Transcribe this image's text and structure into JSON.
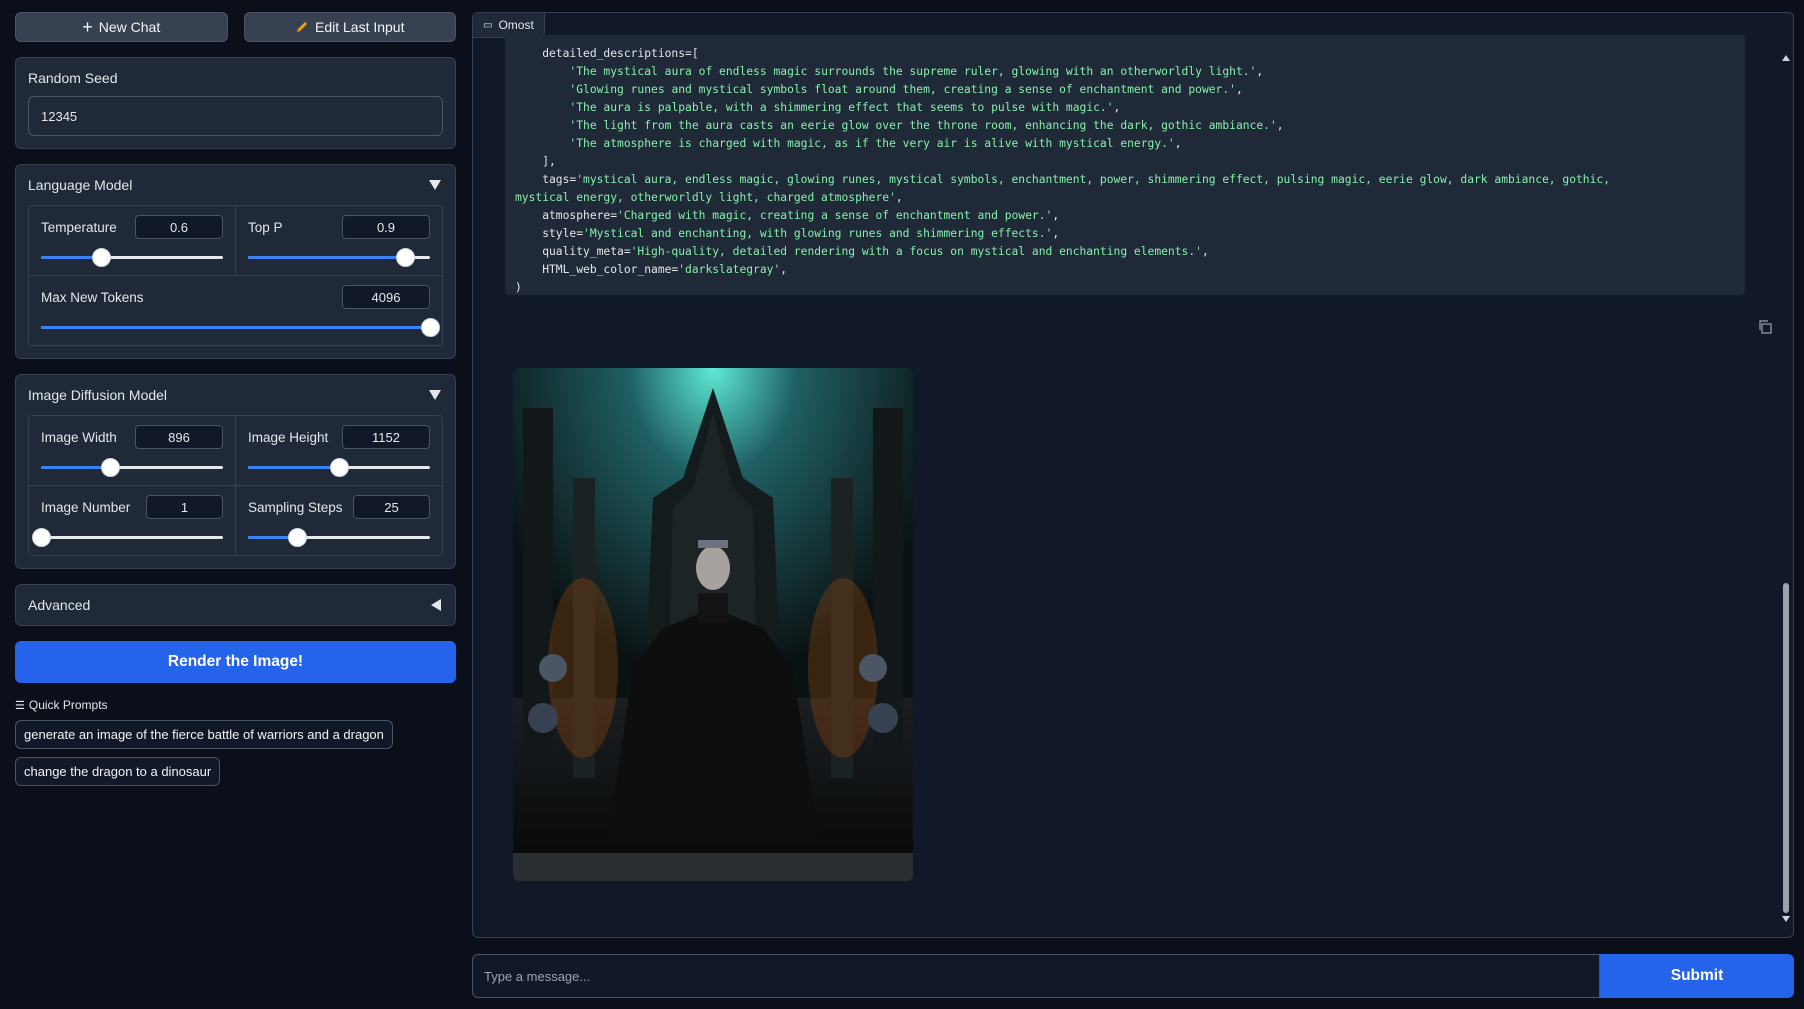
{
  "toolbar": {
    "new_chat": "New Chat",
    "edit_last": "Edit Last Input"
  },
  "seed": {
    "label": "Random Seed",
    "value": "12345"
  },
  "language_model": {
    "title": "Language Model",
    "temperature": {
      "label": "Temperature",
      "value": "0.6",
      "fraction": 0.33
    },
    "top_p": {
      "label": "Top P",
      "value": "0.9",
      "fraction": 0.86
    },
    "max_tokens": {
      "label": "Max New Tokens",
      "value": "4096",
      "fraction": 1.0
    }
  },
  "diffusion_model": {
    "title": "Image Diffusion Model",
    "width": {
      "label": "Image Width",
      "value": "896",
      "fraction": 0.38
    },
    "height": {
      "label": "Image Height",
      "value": "1152",
      "fraction": 0.5
    },
    "number": {
      "label": "Image Number",
      "value": "1",
      "fraction": 0.0
    },
    "steps": {
      "label": "Sampling Steps",
      "value": "25",
      "fraction": 0.27
    }
  },
  "advanced": {
    "title": "Advanced"
  },
  "render_button": "Render the Image!",
  "quick_prompts": {
    "label": "Quick Prompts",
    "items": [
      "generate an image of the fierce battle of warriors and a dragon",
      "change the dragon to a dinosaur"
    ]
  },
  "chat": {
    "tag": "Omost",
    "code": {
      "l1": "    detailed_descriptions=[",
      "l2": "'The mystical aura of endless magic surrounds the supreme ruler, glowing with an otherworldly light.'",
      "l3": "'Glowing runes and mystical symbols float around them, creating a sense of enchantment and power.'",
      "l4": "'The aura is palpable, with a shimmering effect that seems to pulse with magic.'",
      "l5": "'The light from the aura casts an eerie glow over the throne room, enhancing the dark, gothic ambiance.'",
      "l6": "'The atmosphere is charged with magic, as if the very air is alive with mystical energy.'",
      "l7": "    ],",
      "tags_key": "    tags=",
      "tags_val": "'mystical aura, endless magic, glowing runes, mystical symbols, enchantment, power, shimmering effect, pulsing magic, eerie glow, dark ambiance, gothic,\nmystical energy, otherworldly light, charged atmosphere'",
      "atm_key": "    atmosphere=",
      "atm_val": "'Charged with magic, creating a sense of enchantment and power.'",
      "style_key": "    style=",
      "style_val": "'Mystical and enchanting, with glowing runes and shimmering effects.'",
      "qm_key": "    quality_meta=",
      "qm_val": "'High-quality, detailed rendering with a focus on mystical and enchanting elements.'",
      "html_key": "    HTML_web_color_name=",
      "html_val": "'darkslategray'",
      "close": ")"
    }
  },
  "input": {
    "placeholder": "Type a message..."
  },
  "submit": "Submit"
}
